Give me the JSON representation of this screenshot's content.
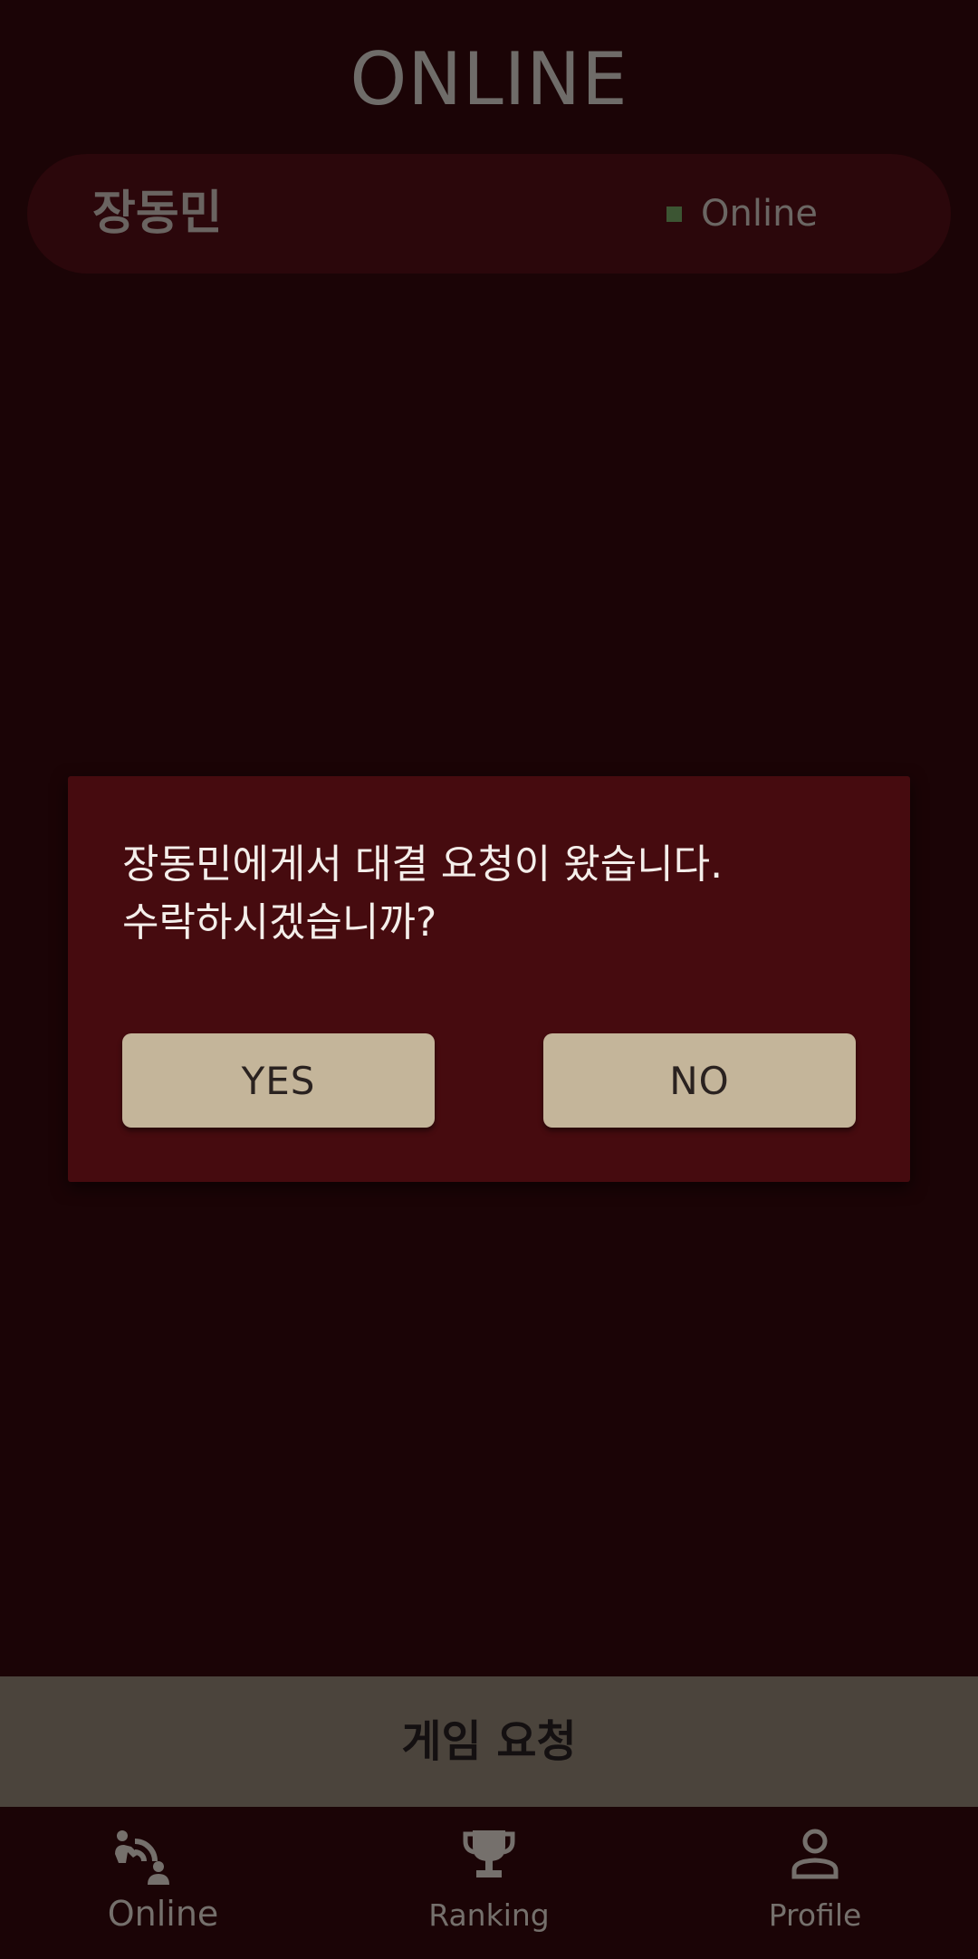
{
  "header": {
    "title": "ONLINE"
  },
  "user_list": [
    {
      "name": "장동민",
      "status": "Online",
      "status_color": "#3c5533"
    }
  ],
  "dialog": {
    "message_line1": "장동민에게서 대결 요청이 왔습니다.",
    "message_line2": "수락하시겠습니까?",
    "yes_label": "YES",
    "no_label": "NO"
  },
  "request_button": {
    "label": "게임 요청"
  },
  "bottom_nav": {
    "items": [
      {
        "label": "Online",
        "icon": "online-players-icon"
      },
      {
        "label": "Ranking",
        "icon": "trophy-icon"
      },
      {
        "label": "Profile",
        "icon": "person-icon"
      }
    ]
  },
  "colors": {
    "background": "#1b0406",
    "dialog_background": "#460b0f",
    "button_background": "#c4b59a",
    "request_bar_background": "#4b443c"
  }
}
